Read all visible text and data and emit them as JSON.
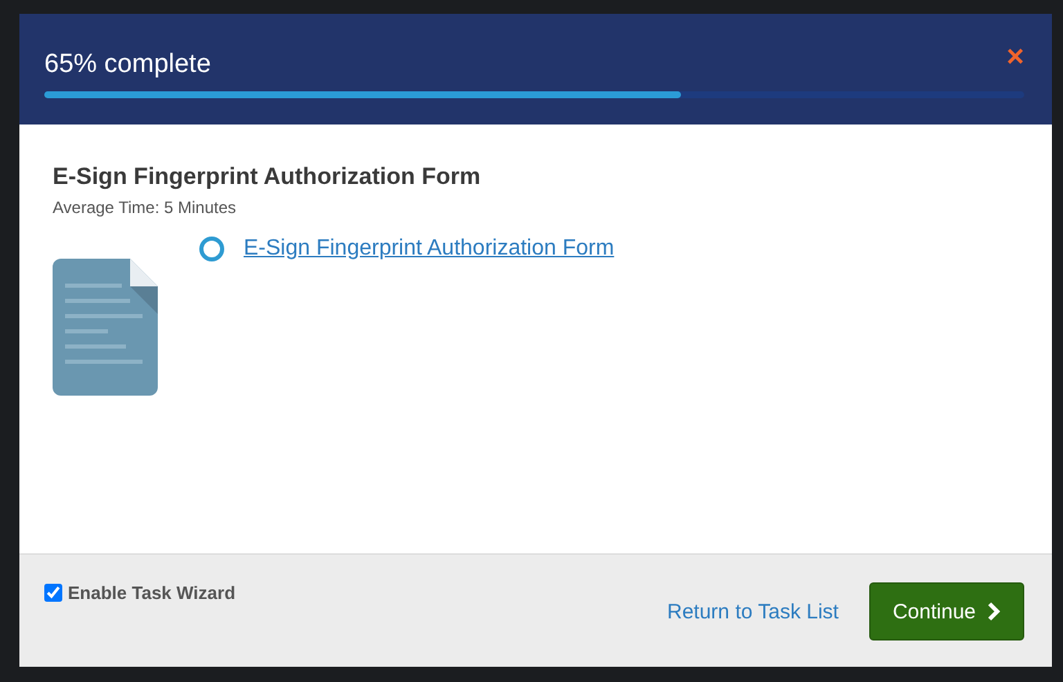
{
  "header": {
    "title": "65% complete",
    "close": "×",
    "progress": {
      "level": 0.65
    }
  },
  "task": {
    "title": "E-Sign Fingerprint Authorization Form",
    "subtitle": "Average Time: 5 Minutes"
  },
  "documents": [
    {
      "label": "E-Sign Fingerprint Authorization Form",
      "selected": false
    }
  ],
  "footer": {
    "wizard": {
      "label": "Enable Task Wizard",
      "checked": true
    },
    "return_link": "Return to Task List",
    "continue": "Continue"
  }
}
